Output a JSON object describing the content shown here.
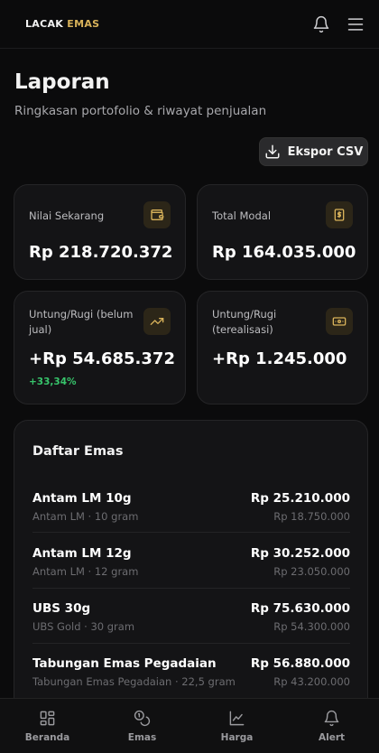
{
  "app": {
    "logo_part1": "LACAK",
    "logo_part2": "EMAS"
  },
  "header": {
    "title": "Laporan",
    "subtitle": "Ringkasan portofolio & riwayat penjualan",
    "export_label": "Ekspor CSV"
  },
  "stats": {
    "current_value": {
      "label": "Nilai Sekarang",
      "value": "Rp 218.720.372",
      "icon": "wallet-icon"
    },
    "total_capital": {
      "label": "Total Modal",
      "value": "Rp 164.035.000",
      "icon": "receipt-icon"
    },
    "unrealized": {
      "label": "Untung/Rugi (belum jual)",
      "value": "+Rp 54.685.372",
      "change": "+33,34%",
      "icon": "trending-up-icon"
    },
    "realized": {
      "label": "Untung/Rugi (terealisasi)",
      "value": "+Rp 1.245.000",
      "icon": "banknote-icon"
    }
  },
  "gold_list": {
    "title": "Daftar Emas",
    "items": [
      {
        "name": "Antam LM 10g",
        "meta": "Antam LM · 10 gram",
        "price": "Rp 25.210.000",
        "cost": "Rp 18.750.000"
      },
      {
        "name": "Antam LM 12g",
        "meta": "Antam LM · 12 gram",
        "price": "Rp 30.252.000",
        "cost": "Rp 23.050.000"
      },
      {
        "name": "UBS 30g",
        "meta": "UBS Gold · 30 gram",
        "price": "Rp 75.630.000",
        "cost": "Rp 54.300.000"
      },
      {
        "name": "Tabungan Emas Pegadaian",
        "meta": "Tabungan Emas Pegadaian · 22,5 gram",
        "price": "Rp 56.880.000",
        "cost": "Rp 43.200.000"
      }
    ]
  },
  "nav": {
    "items": [
      {
        "label": "Beranda",
        "icon": "grid-icon"
      },
      {
        "label": "Emas",
        "icon": "coins-icon"
      },
      {
        "label": "Harga",
        "icon": "chart-icon"
      },
      {
        "label": "Alert",
        "icon": "bell-icon"
      }
    ]
  },
  "colors": {
    "accent_gold": "#d8b25a",
    "positive": "#37c46b",
    "background": "#0b0b0c",
    "card": "#141416"
  }
}
